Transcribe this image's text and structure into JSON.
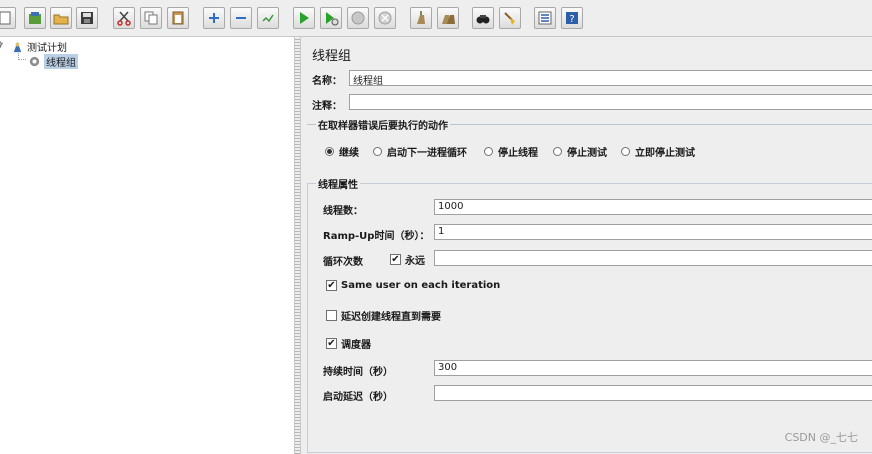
{
  "toolbar": {
    "buttons": [
      {
        "name": "new-icon"
      },
      {
        "name": "templates-icon"
      },
      {
        "name": "open-icon"
      },
      {
        "name": "save-icon"
      },
      {
        "name": "cut-icon"
      },
      {
        "name": "copy-icon"
      },
      {
        "name": "paste-icon"
      },
      {
        "name": "expand-icon"
      },
      {
        "name": "collapse-icon"
      },
      {
        "name": "toggle-icon"
      },
      {
        "name": "start-icon"
      },
      {
        "name": "start-no-timers-icon"
      },
      {
        "name": "stop-icon"
      },
      {
        "name": "shutdown-icon"
      },
      {
        "name": "clear-icon"
      },
      {
        "name": "clear-all-icon"
      },
      {
        "name": "search-icon"
      },
      {
        "name": "reset-search-icon"
      },
      {
        "name": "function-helper-icon"
      },
      {
        "name": "help-icon"
      }
    ]
  },
  "tree": {
    "root": "测试计划",
    "child": "线程组"
  },
  "panel": {
    "title": "线程组",
    "name_label": "名称：",
    "name_value": "线程组",
    "comment_label": "注释：",
    "comment_value": "",
    "error_action": {
      "title": "在取样器错误后要执行的动作",
      "options": [
        "继续",
        "启动下一进程循环",
        "停止线程",
        "停止测试",
        "立即停止测试"
      ],
      "selected": "继续"
    },
    "thread_props": {
      "title": "线程属性",
      "threads_label": "线程数：",
      "threads_value": "1000",
      "rampup_label": "Ramp-Up时间（秒）：",
      "rampup_value": "1",
      "loop_label": "循环次数",
      "forever_label": "永远",
      "forever_checked": true,
      "loop_value": "",
      "same_user_label": "Same user on each iteration",
      "same_user_checked": true,
      "delay_create_label": "延迟创建线程直到需要",
      "delay_create_checked": false,
      "scheduler_label": "调度器",
      "scheduler_checked": true,
      "duration_label": "持续时间（秒）",
      "duration_value": "300",
      "startup_delay_label": "启动延迟（秒）",
      "startup_delay_value": ""
    }
  },
  "watermark": "CSDN @_七七"
}
